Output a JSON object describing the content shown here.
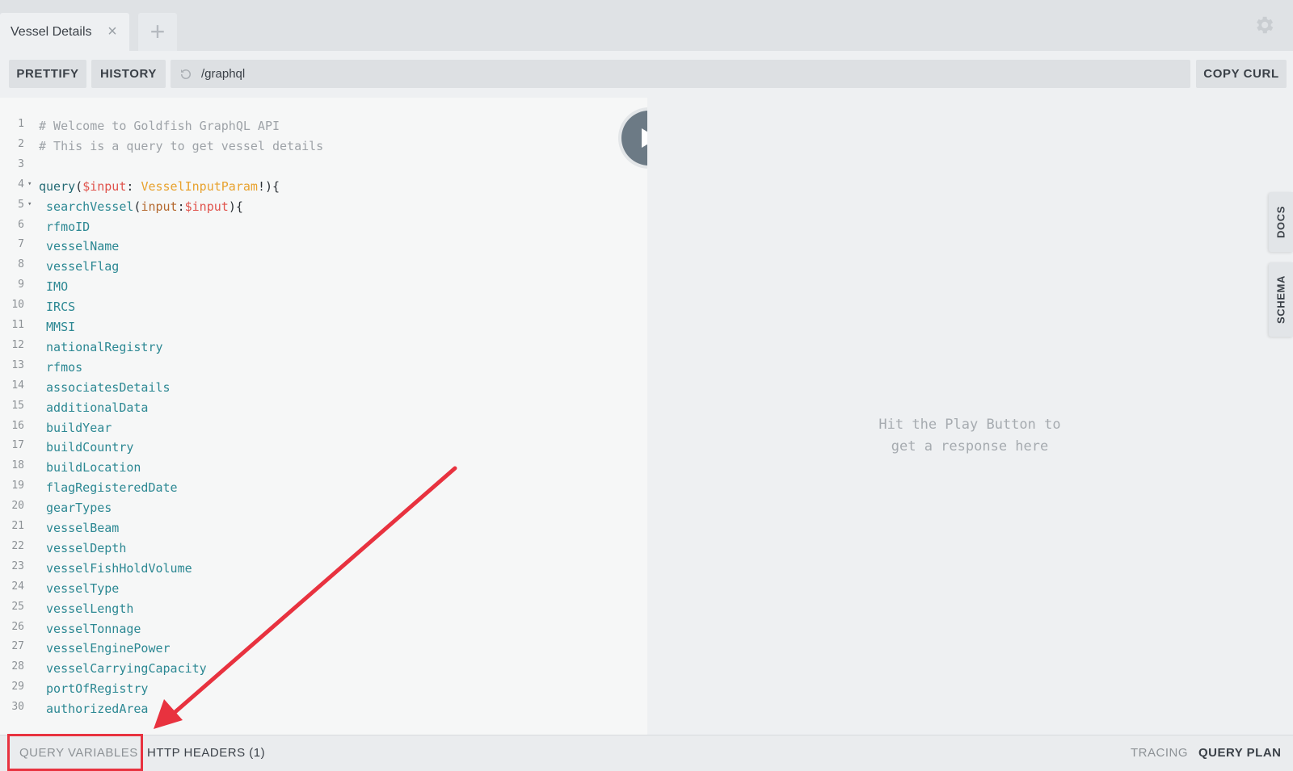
{
  "tab": {
    "title": "Vessel Details",
    "close": "×",
    "add": "+"
  },
  "toolbar": {
    "prettify": "PRETTIFY",
    "history": "HISTORY",
    "url": "/graphql",
    "copy_curl": "COPY CURL"
  },
  "editor": {
    "lines": [
      {
        "n": "1",
        "fold": "",
        "tokens": [
          [
            "c-comment",
            "# Welcome to Goldfish GraphQL API"
          ]
        ]
      },
      {
        "n": "2",
        "fold": "",
        "tokens": [
          [
            "c-comment",
            "# This is a query to get vessel details"
          ]
        ]
      },
      {
        "n": "3",
        "fold": "",
        "tokens": []
      },
      {
        "n": "4",
        "fold": "▾",
        "tokens": [
          [
            "c-kw",
            "query"
          ],
          [
            "c-punc",
            "("
          ],
          [
            "c-var",
            "$input"
          ],
          [
            "c-punc",
            ": "
          ],
          [
            "c-type",
            "VesselInputParam"
          ],
          [
            "c-punc",
            "!){"
          ]
        ]
      },
      {
        "n": "5",
        "fold": "▾",
        "tokens": [
          [
            "c-punc",
            " "
          ],
          [
            "c-field",
            "searchVessel"
          ],
          [
            "c-punc",
            "("
          ],
          [
            "c-arg",
            "input"
          ],
          [
            "c-punc",
            ":"
          ],
          [
            "c-var",
            "$input"
          ],
          [
            "c-punc",
            "){"
          ]
        ]
      },
      {
        "n": "6",
        "fold": "",
        "tokens": [
          [
            "c-field",
            " rfmoID"
          ]
        ]
      },
      {
        "n": "7",
        "fold": "",
        "tokens": [
          [
            "c-field",
            " vesselName"
          ]
        ]
      },
      {
        "n": "8",
        "fold": "",
        "tokens": [
          [
            "c-field",
            " vesselFlag"
          ]
        ]
      },
      {
        "n": "9",
        "fold": "",
        "tokens": [
          [
            "c-field",
            " IMO"
          ]
        ]
      },
      {
        "n": "10",
        "fold": "",
        "tokens": [
          [
            "c-field",
            " IRCS"
          ]
        ]
      },
      {
        "n": "11",
        "fold": "",
        "tokens": [
          [
            "c-field",
            " MMSI"
          ]
        ]
      },
      {
        "n": "12",
        "fold": "",
        "tokens": [
          [
            "c-field",
            " nationalRegistry"
          ]
        ]
      },
      {
        "n": "13",
        "fold": "",
        "tokens": [
          [
            "c-field",
            " rfmos"
          ]
        ]
      },
      {
        "n": "14",
        "fold": "",
        "tokens": [
          [
            "c-field",
            " associatesDetails"
          ]
        ]
      },
      {
        "n": "15",
        "fold": "",
        "tokens": [
          [
            "c-field",
            " additionalData"
          ]
        ]
      },
      {
        "n": "16",
        "fold": "",
        "tokens": [
          [
            "c-field",
            " buildYear"
          ]
        ]
      },
      {
        "n": "17",
        "fold": "",
        "tokens": [
          [
            "c-field",
            " buildCountry"
          ]
        ]
      },
      {
        "n": "18",
        "fold": "",
        "tokens": [
          [
            "c-field",
            " buildLocation"
          ]
        ]
      },
      {
        "n": "19",
        "fold": "",
        "tokens": [
          [
            "c-field",
            " flagRegisteredDate"
          ]
        ]
      },
      {
        "n": "20",
        "fold": "",
        "tokens": [
          [
            "c-field",
            " gearTypes"
          ]
        ]
      },
      {
        "n": "21",
        "fold": "",
        "tokens": [
          [
            "c-field",
            " vesselBeam"
          ]
        ]
      },
      {
        "n": "22",
        "fold": "",
        "tokens": [
          [
            "c-field",
            " vesselDepth"
          ]
        ]
      },
      {
        "n": "23",
        "fold": "",
        "tokens": [
          [
            "c-field",
            " vesselFishHoldVolume"
          ]
        ]
      },
      {
        "n": "24",
        "fold": "",
        "tokens": [
          [
            "c-field",
            " vesselType"
          ]
        ]
      },
      {
        "n": "25",
        "fold": "",
        "tokens": [
          [
            "c-field",
            " vesselLength"
          ]
        ]
      },
      {
        "n": "26",
        "fold": "",
        "tokens": [
          [
            "c-field",
            " vesselTonnage"
          ]
        ]
      },
      {
        "n": "27",
        "fold": "",
        "tokens": [
          [
            "c-field",
            " vesselEnginePower"
          ]
        ]
      },
      {
        "n": "28",
        "fold": "",
        "tokens": [
          [
            "c-field",
            " vesselCarryingCapacity"
          ]
        ]
      },
      {
        "n": "29",
        "fold": "",
        "tokens": [
          [
            "c-field",
            " portOfRegistry"
          ]
        ]
      },
      {
        "n": "30",
        "fold": "",
        "tokens": [
          [
            "c-field",
            " authorizedArea"
          ]
        ]
      }
    ]
  },
  "response": {
    "hint_line1": "Hit the Play Button to",
    "hint_line2": "get a response here"
  },
  "side_tabs": {
    "docs": "DOCS",
    "schema": "SCHEMA"
  },
  "bottom": {
    "query_variables": "QUERY VARIABLES",
    "http_headers": "HTTP HEADERS (1)",
    "tracing": "TRACING",
    "query_plan": "QUERY PLAN"
  },
  "colors": {
    "highlight": "#e8323f",
    "arrow": "#e8323f",
    "play_button": "#6c7a85"
  },
  "icons": {
    "gear": "gear-icon",
    "play": "play-icon",
    "reload": "reload-icon"
  }
}
